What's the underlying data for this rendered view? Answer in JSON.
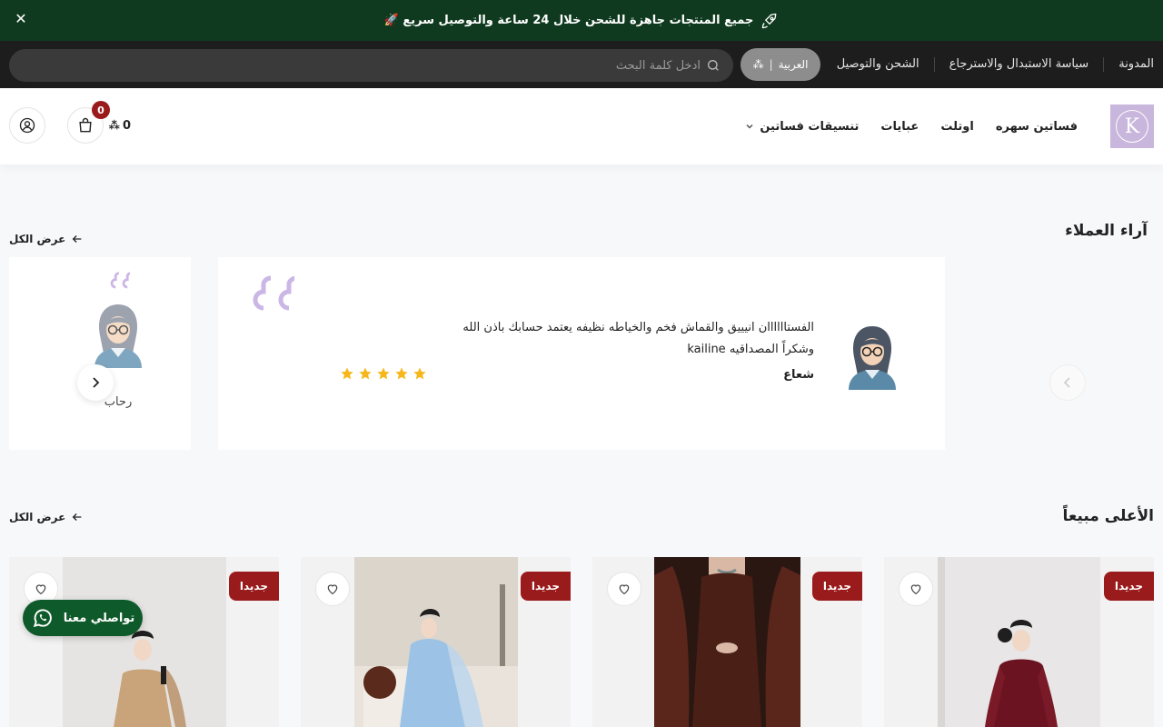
{
  "announcement": {
    "text": "جميع المنتجات جاهزة للشحن خلال 24 ساعة والتوصيل سريع 🚀",
    "close_icon": "close-icon",
    "icon": "rocket-icon"
  },
  "topbar": {
    "links": [
      "المدونة",
      "سياسة الاستبدال والاسترجاع",
      "الشحن والتوصيل"
    ],
    "language": "العربية",
    "currency_symbol": "⃁",
    "search_placeholder": "ادخل كلمة البحث"
  },
  "header": {
    "logo_letter": "K",
    "nav": [
      "فساتين سهره",
      "اوتلت",
      "عبايات",
      "تنسيقات فساتين"
    ],
    "cart_count": "0",
    "cart_total": "0",
    "currency": "⃁"
  },
  "testimonials": {
    "title": "آراء العملاء",
    "view_all": "عرض الكل",
    "main": {
      "text": "الفستاااااان انيييق والقماش فخم والخياطه نظيفه يعتمد حسابك باذن الله وشكراً المصداقيه kailine",
      "name": "شعاع",
      "rating": 5
    },
    "side": {
      "name": "رحاب"
    }
  },
  "bestsellers": {
    "title": "الأعلى مبيعاً",
    "view_all": "عرض الكل",
    "badge": "جديدا"
  },
  "whatsapp": {
    "label": "تواصلي معنا"
  },
  "colors": {
    "announce_bg": "#0f3a1f",
    "topbar_bg": "#1d1d1d",
    "badge": "#9a1b1b",
    "star": "#f5b71a",
    "logo_bg": "#c9b6dc",
    "whatsapp": "#0f5a2a"
  }
}
